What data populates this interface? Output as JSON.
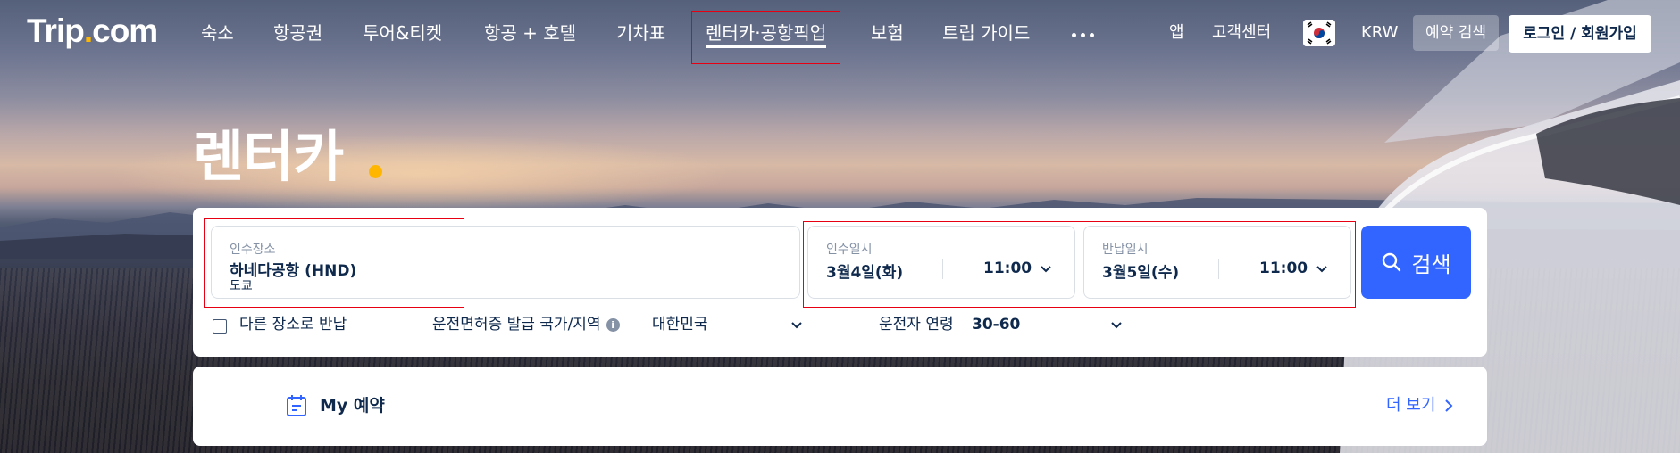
{
  "brand": {
    "logo_main": "Trip",
    "logo_dot": ".",
    "logo_suffix": "com"
  },
  "nav": {
    "items": [
      "숙소",
      "항공권",
      "투어&티켓",
      "항공 + 호텔",
      "기차표",
      "렌터카·공항픽업",
      "보험",
      "트립 가이드"
    ],
    "active_index": 5,
    "more_icon": "more-dots-icon",
    "app": "앱",
    "support": "고객센터",
    "currency": "KRW",
    "find_booking": "예약 검색",
    "login": "로그인 / 회원가입"
  },
  "page": {
    "title": "렌터카"
  },
  "search": {
    "pickup": {
      "label": "인수장소",
      "value": "하네다공항 (HND)",
      "city": "도쿄"
    },
    "pickup_time": {
      "label": "인수일시",
      "date": "3월4일(화)",
      "time": "11:00"
    },
    "return_time": {
      "label": "반납일시",
      "date": "3월5일(수)",
      "time": "11:00"
    },
    "search_button": "검색",
    "return_elsewhere": "다른 장소로 반납",
    "license_label": "운전면허증 발급 국가/지역",
    "license_value": "대한민국",
    "age_label": "운전자 연령",
    "age_value": "30-60"
  },
  "my_booking": {
    "title": "My 예약",
    "more": "더 보기"
  },
  "colors": {
    "primary": "#3264ff",
    "accent": "#ffb600",
    "highlight": "#e60012",
    "text": "#0f294d"
  }
}
